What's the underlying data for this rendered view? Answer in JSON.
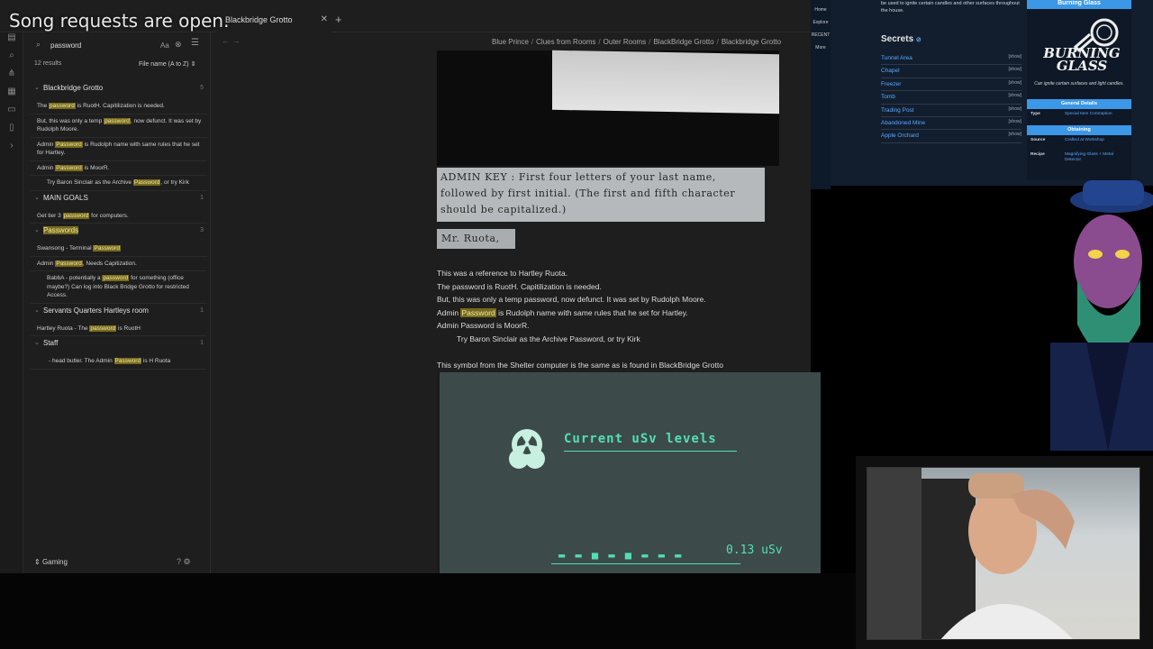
{
  "stream": {
    "overlay_text": "Song requests are open."
  },
  "tabs": [
    {
      "label": "Blackbridge Grotto"
    }
  ],
  "sidebar": {
    "search_value": "password",
    "case_toggle": "Aa",
    "results_count": "12 results",
    "sort_label": "File name (A to Z)",
    "groups": [
      {
        "title": "Blackbridge Grotto",
        "count": "5",
        "matches": [
          [
            "The ",
            {
              "m": "password"
            },
            " is RuotH. Capitilization is needed."
          ],
          [
            "But, this was only a temp ",
            {
              "m": "password"
            },
            ", now defunct. It was set by Rudolph Moore."
          ],
          [
            "Admin ",
            {
              "m": "Password"
            },
            " is Rudolph name with same rules that he set for Hartley."
          ],
          [
            "Admin ",
            {
              "m": "Password"
            },
            " is MoorR."
          ],
          [
            "Try Baron Sinclair as the Archive ",
            {
              "m": "Password"
            },
            ", or try Kirk"
          ]
        ]
      },
      {
        "title": "MAIN GOALS",
        "count": "1",
        "matches": [
          [
            "Get tier 3 ",
            {
              "m": "password"
            },
            " for computers."
          ]
        ]
      },
      {
        "title": "Passwords",
        "count": "3",
        "highlight": true,
        "matches": [
          [
            "Swansong - Terminal ",
            {
              "m": "Password"
            }
          ],
          [
            "Admin ",
            {
              "m": "Password"
            },
            ", Needs Capitization."
          ],
          [
            "BabbA - potentially a ",
            {
              "m": "password"
            },
            " for something (office maybe?) Can log into Black Bridge Grotto for restricted Access."
          ]
        ]
      },
      {
        "title": "Servants Quarters Hartleys room",
        "count": "1",
        "matches": [
          [
            "Hartley Ruota - The ",
            {
              "m": "password"
            },
            " is RuotH"
          ]
        ]
      },
      {
        "title": "Staff",
        "count": "1",
        "matches": [
          [
            "- head butler. The Admin ",
            {
              "m": "Password"
            },
            " is H Ruota"
          ]
        ]
      }
    ],
    "vault_name": "Gaming"
  },
  "main": {
    "breadcrumb": [
      "Blue Prince",
      "Clues from Rooms",
      "Outer Rooms",
      "BlackBridge Grotto",
      "Blackbridge Grotto"
    ],
    "admin_key_text": "ADMIN KEY : First four letters of your last name, followed by first initial. (The first and fifth character should be capitalized.)",
    "mr_ruota_text": "Mr. Ruota,",
    "lines": [
      [
        "This was a reference to Hartley Ruota."
      ],
      [
        "The password is RuotH. Capitilization is needed."
      ],
      [
        "But, this was only a temp password, now defunct. It was set by Rudolph Moore."
      ],
      [
        "Admin ",
        {
          "m": "Password"
        },
        " is Rudolph name with same rules that he set for Hartley."
      ],
      [
        "Admin Password is MoorR."
      ]
    ],
    "indent_line": "Try Baron Sinclair as the Archive Password, or try Kirk",
    "symbol_line": "This symbol from the Shelter computer is the same as is found in BlackBridge Grotto",
    "screen_title": "Current uSv levels",
    "screen_value": "0.13 uSv"
  },
  "wiki": {
    "intro": "be used to ignite certain candles and other surfaces throughout the house.",
    "secrets_heading": "Secrets",
    "secret_links": [
      "Tunnel Area",
      "Chapel",
      "Freezer",
      "Tomb",
      "Trading Post",
      "Abandoned Mine",
      "Apple Orchard"
    ],
    "show_label": "[show]",
    "infobox": {
      "title": "Burning Glass",
      "logo_text": "BURNING GLASS",
      "caption": "Can ignite certain surfaces and light candles.",
      "general_heading": "General Details",
      "type_key": "Type",
      "type_val": "Special Item Contraption",
      "obtaining_heading": "Obtaining",
      "source_key": "Source",
      "source_val": "Crafted at Workshop",
      "recipe_key": "Recipe",
      "recipe_val": "Magnifying Glass + Metal Detector"
    },
    "nav_labels": [
      "Home",
      "Explore",
      "RECENT",
      "More"
    ]
  },
  "colors": {
    "accent": "#3c97e6",
    "highlight": "#776a1e",
    "terminal_green": "#52e0b0"
  }
}
